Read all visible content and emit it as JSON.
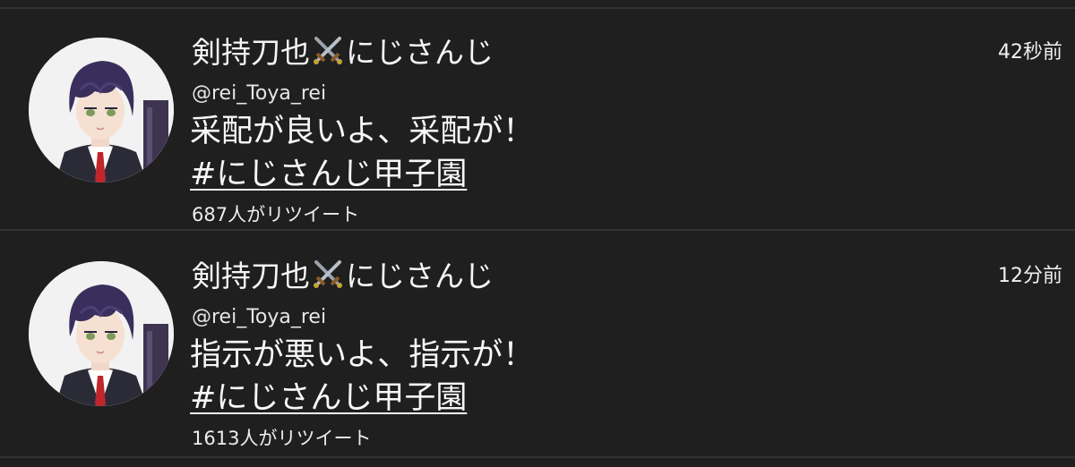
{
  "colors": {
    "background": "#1f1f1f",
    "divider": "#333333",
    "text": "#f2f2f2"
  },
  "tweets": [
    {
      "name_left": "剣持刀也",
      "name_icon": "crossed-swords-icon",
      "name_right": "にじさんじ",
      "handle": "@rei_Toya_rei",
      "time": "42秒前",
      "body": "采配が良いよ、采配が！",
      "hashtag": "#にじさんじ甲子園",
      "retweets": "687人がリツイート"
    },
    {
      "name_left": "剣持刀也",
      "name_icon": "crossed-swords-icon",
      "name_right": "にじさんじ",
      "handle": "@rei_Toya_rei",
      "time": "12分前",
      "body": "指示が悪いよ、指示が！",
      "hashtag": "#にじさんじ甲子園",
      "retweets": "1613人がリツイート"
    }
  ]
}
